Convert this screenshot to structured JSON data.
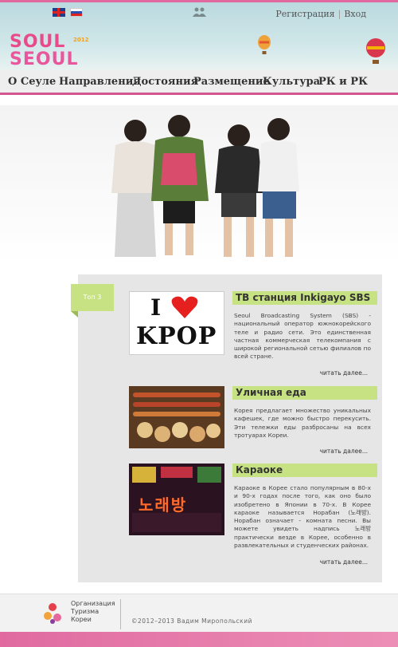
{
  "header": {
    "auth": {
      "register": "Регистрация",
      "separator": "|",
      "login": "Вход"
    },
    "logo": {
      "line1": "SOUL",
      "line2": "SEOUL",
      "year": "2012"
    }
  },
  "nav": {
    "items": [
      "О Сеуле",
      "Направления",
      "Достояния",
      "Размещение",
      "Культура",
      "РК и РК"
    ]
  },
  "top": {
    "tag": "Топ 3"
  },
  "articles": [
    {
      "title": "ТВ станция Inkigayo SBS",
      "thumb_text_i": "I",
      "thumb_text_kpop": "KPOP",
      "body": "Seoul Broadcasting System (SBS) - национальный оператор южнокорейского теле и радио сети. Это единственная частная коммерческая телекомпания с широкой региональной сетью филиалов по всей стране.",
      "more": "читать далее..."
    },
    {
      "title": "Уличная еда",
      "body": "Корея предлагает множество уникальных кафешек, где можно быстро перекусить. Эти тележки еды разбросаны на всех тротуарах Кореи.",
      "more": "читать далее..."
    },
    {
      "title": "Караоке",
      "thumb_text": "노래방",
      "body": "Караоке в Корее стало популярным в 80-х и 90-х годах после того, как оно было изобретено в Японии в 70-х. В Корее караоке называется Норабан (노래방). Норабан означает - комната песни. Вы можете увидеть надпись 노래방 практически везде в Корее, особенно в развлекательных и студенческих районах.",
      "more": "читать далее..."
    }
  ],
  "footer": {
    "org_line1": "Организация",
    "org_line2": "Туризма",
    "org_line3": "Кореи",
    "copyright": "©2012–2013 Вадим Миропольский"
  },
  "colors": {
    "accent_pink": "#e06aa0",
    "accent_green": "#c7e283",
    "panel_grey": "#e6e6e6"
  }
}
